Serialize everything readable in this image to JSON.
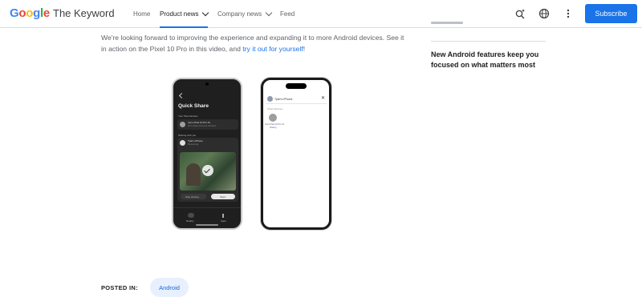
{
  "header": {
    "logo": "Google",
    "site_title": "The Keyword",
    "nav": [
      {
        "label": "Home",
        "active": false,
        "dropdown": false
      },
      {
        "label": "Product news",
        "active": true,
        "dropdown": true
      },
      {
        "label": "Company news",
        "active": false,
        "dropdown": true
      },
      {
        "label": "Feed",
        "active": false,
        "dropdown": false
      }
    ],
    "icons": [
      "sparkle-search-icon",
      "globe-icon",
      "more-vert-icon"
    ],
    "subscribe_label": "Subscribe",
    "accent": "#1a73e8"
  },
  "article": {
    "paragraph_text": "We're looking forward to improving the experience and expanding it to more Android devices. See it in action on the Pixel 10 Pro in this video, and ",
    "link_text": "try it out for yourself",
    "after_link": "!"
  },
  "sidebar": {
    "related_title": "New Android features keep you focused on what matters most"
  },
  "phone_left": {
    "screen_title": "Quick Share",
    "section_1": "Your Pixel devices",
    "device_1_name": "Joy's Pixel 10 Pro XL",
    "device_1_sub": "Not shared across devices",
    "section_2": "Sharing with you",
    "device_2_name": "Tyler's iPhone",
    "device_2_sub": "Receiving",
    "btn_left": "Stop sharing",
    "btn_right": "Open",
    "tab_1": "Nearby",
    "tab_2": "Apps"
  },
  "phone_right": {
    "header_name": "Tyler's iPhone",
    "section": "Other Devices",
    "device_name": "Joy's Pixel 10 Pro XL",
    "device_sub": "Waiting"
  },
  "footer": {
    "posted_in_label": "POSTED IN:",
    "tag": "Android"
  }
}
